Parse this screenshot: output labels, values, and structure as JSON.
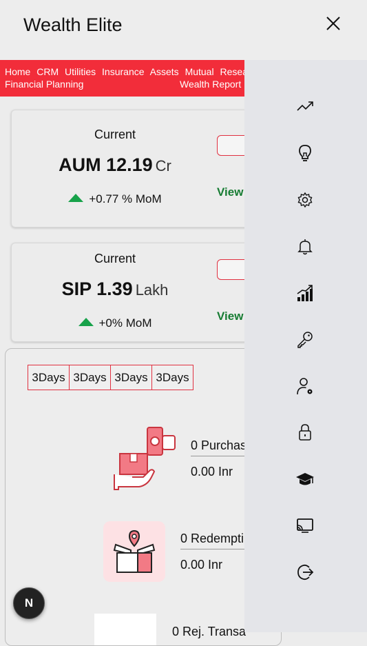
{
  "header": {
    "title": "Wealth Elite",
    "close_icon": "close-icon"
  },
  "nav": {
    "items": [
      "Home",
      "CRM",
      "Utilities",
      "Insurance",
      "Assets",
      "Mutual",
      "Research"
    ],
    "items_row2_left": "Financial Planning",
    "items_row2_right": "Wealth Report",
    "bg_color": "#f22d3a"
  },
  "aum_card": {
    "current_label": "Current",
    "metric": "AUM 12.19",
    "unit": "Cr",
    "mom": "+0.77 % MoM",
    "view_label": "View"
  },
  "sip_card": {
    "current_label": "Current",
    "metric": "SIP 1.39",
    "unit": "Lakh",
    "mom": "+0% MoM",
    "view_label": "View"
  },
  "transactions": {
    "tabs": [
      "3Days",
      "3Days",
      "3Days",
      "3Days"
    ],
    "purchase": {
      "label": "0 Purchas",
      "value": "0.00 Inr",
      "icon": "purchase-hand-box-icon"
    },
    "redemption": {
      "label": "0 Redempti",
      "value": "0.00 Inr",
      "icon": "gift-box-location-icon"
    },
    "rejected": {
      "label": "0 Rej. Transa"
    }
  },
  "sidebar": {
    "icons": [
      "trending-up-icon",
      "lightbulb-icon",
      "gear-icon",
      "bell-icon",
      "bar-chart-icon",
      "key-icon",
      "user-settings-icon",
      "lock-icon",
      "graduation-cap-icon",
      "cast-icon",
      "logout-icon"
    ]
  },
  "fab": {
    "label": "N"
  },
  "colors": {
    "accent_red": "#f22d3a",
    "positive_green": "#17a24a",
    "view_green": "#177c33"
  }
}
